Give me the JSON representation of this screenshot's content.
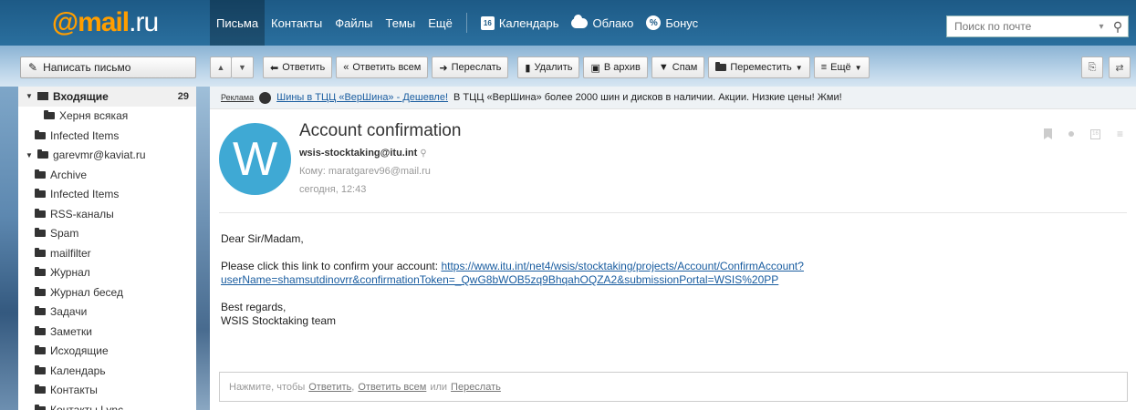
{
  "header": {
    "logo_main": "@mail",
    "logo_tld": ".ru",
    "nav": [
      {
        "label": "Письма"
      },
      {
        "label": "Контакты"
      },
      {
        "label": "Файлы"
      },
      {
        "label": "Темы"
      },
      {
        "label": "Ещё"
      }
    ],
    "services": [
      {
        "label": "Календарь",
        "icon_text": "16"
      },
      {
        "label": "Облако"
      },
      {
        "label": "Бонус"
      }
    ],
    "search_placeholder": "Поиск по почте",
    "search_dropdown": "▾",
    "search_icon": "🔍"
  },
  "compose": {
    "label": "Написать письмо"
  },
  "toolbar": {
    "up": "▲",
    "down": "▼",
    "reply": "Ответить",
    "reply_all": "Ответить всем",
    "forward": "Переслать",
    "delete": "Удалить",
    "archive": "В архив",
    "spam": "Спам",
    "move": "Переместить",
    "more": "Ещё"
  },
  "sidebar": {
    "inbox": {
      "label": "Входящие",
      "count": "29"
    },
    "folders": [
      {
        "label": "Херня всякая",
        "indent": 2
      },
      {
        "label": "Infected Items",
        "indent": 1
      },
      {
        "label": "garevmr@kaviat.ru",
        "indent": 0,
        "expander": "▼"
      },
      {
        "label": "Archive",
        "indent": 1
      },
      {
        "label": "Infected Items",
        "indent": 1
      },
      {
        "label": "RSS-каналы",
        "indent": 1
      },
      {
        "label": "Spam",
        "indent": 1
      },
      {
        "label": "mailfilter",
        "indent": 1
      },
      {
        "label": "Журнал",
        "indent": 1
      },
      {
        "label": "Журнал бесед",
        "indent": 1
      },
      {
        "label": "Задачи",
        "indent": 1
      },
      {
        "label": "Заметки",
        "indent": 1
      },
      {
        "label": "Исходящие",
        "indent": 1
      },
      {
        "label": "Календарь",
        "indent": 1
      },
      {
        "label": "Контакты",
        "indent": 1
      },
      {
        "label": "Контакты Lync",
        "indent": 1
      }
    ]
  },
  "ad": {
    "tag": "Реклама",
    "link": "Шины в ТЦЦ «ВерШина» - Дешевле!",
    "text": "В ТЦЦ «ВерШина» более 2000 шин и дисков в наличии. Акции. Низкие цены! Жми!"
  },
  "message": {
    "avatar_letter": "W",
    "subject": "Account confirmation",
    "from": "wsis-stocktaking@itu.int",
    "to": "Кому: maratgarev96@mail.ru",
    "date": "сегодня, 12:43",
    "greeting": "Dear Sir/Madam,",
    "intro": "Please click this link to confirm your account: ",
    "link_line1": "https://www.itu.int/net4/wsis/stocktaking/projects/Account/ConfirmAccount?",
    "link_line2": "userName=shamsutdinovrr&confirmationToken=_QwG8bWOB5zq9BhqahOQZA2&submissionPortal=WSIS%20PP",
    "regards": "Best regards,",
    "signature": "WSIS Stocktaking team"
  },
  "reply_box": {
    "prefix": "Нажмите, чтобы",
    "reply": "Ответить",
    "comma": ",",
    "reply_all": "Ответить всем",
    "or": "или",
    "forward": "Переслать"
  }
}
